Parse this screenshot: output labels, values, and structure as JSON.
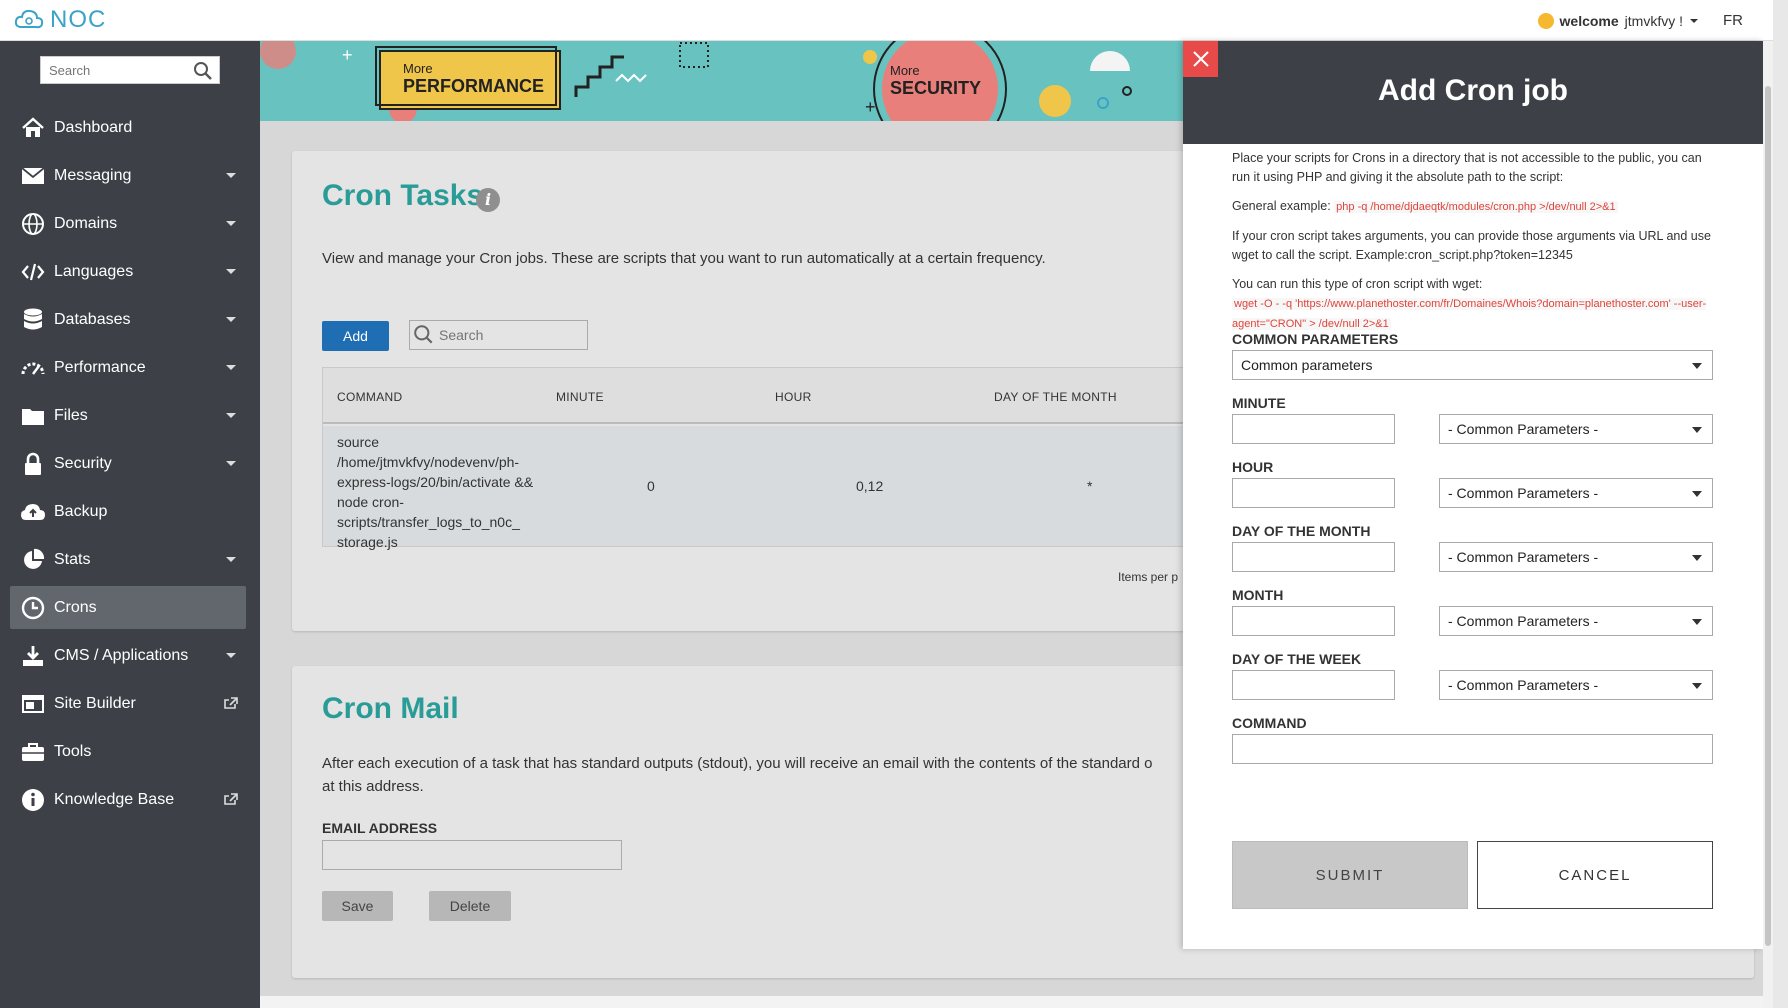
{
  "app": {
    "logo_text": "NOC"
  },
  "topbar": {
    "welcome_bold": "welcome",
    "username": "jtmvkfvy !",
    "language": "FR"
  },
  "sidebar": {
    "search_placeholder": "Search",
    "items": [
      {
        "label": "Dashboard",
        "icon": "home-icon",
        "caret": false,
        "external": false
      },
      {
        "label": "Messaging",
        "icon": "envelope-icon",
        "caret": true,
        "external": false
      },
      {
        "label": "Domains",
        "icon": "globe-icon",
        "caret": true,
        "external": false
      },
      {
        "label": "Languages",
        "icon": "code-icon",
        "caret": true,
        "external": false
      },
      {
        "label": "Databases",
        "icon": "database-icon",
        "caret": true,
        "external": false
      },
      {
        "label": "Performance",
        "icon": "gauge-icon",
        "caret": true,
        "external": false
      },
      {
        "label": "Files",
        "icon": "folder-icon",
        "caret": true,
        "external": false
      },
      {
        "label": "Security",
        "icon": "lock-icon",
        "caret": true,
        "external": false
      },
      {
        "label": "Backup",
        "icon": "cloud-upload-icon",
        "caret": false,
        "external": false
      },
      {
        "label": "Stats",
        "icon": "pie-chart-icon",
        "caret": true,
        "external": false
      },
      {
        "label": "Crons",
        "icon": "clock-icon",
        "caret": false,
        "external": false,
        "active": true
      },
      {
        "label": "CMS / Applications",
        "icon": "download-icon",
        "caret": true,
        "external": false
      },
      {
        "label": "Site Builder",
        "icon": "browser-icon",
        "caret": false,
        "external": true
      },
      {
        "label": "Tools",
        "icon": "toolbox-icon",
        "caret": false,
        "external": false
      },
      {
        "label": "Knowledge Base",
        "icon": "info-circle-icon",
        "caret": false,
        "external": true
      }
    ]
  },
  "banner": {
    "perf_small": "More",
    "perf_big": "PERFORMANCE",
    "sec_small": "More",
    "sec_big": "SECURITY"
  },
  "cron_tasks": {
    "title": "Cron Tasks",
    "description": "View and manage your Cron jobs. These are scripts that you want to run automatically at a certain frequency.",
    "add_label": "Add",
    "search_placeholder": "Search",
    "columns": [
      "COMMAND",
      "MINUTE",
      "HOUR",
      "DAY OF THE MONTH"
    ],
    "rows": [
      {
        "command": "source /home/jtmvkfvy/nodevenv/ph-express-logs/20/bin/activate && node cron-scripts/transfer_logs_to_n0c_ storage.js",
        "minute": "0",
        "hour": "0,12",
        "day": "*"
      }
    ],
    "items_per_page": "Items per p"
  },
  "cron_mail": {
    "title": "Cron Mail",
    "description_line1": "After each execution of a task that has standard outputs (stdout), you will receive an email with the contents of the standard o",
    "description_line2": "at this address.",
    "email_label": "EMAIL ADDRESS",
    "save_label": "Save",
    "delete_label": "Delete"
  },
  "panel": {
    "title": "Add Cron job",
    "intro": "Place your scripts for Crons in a directory that is not accessible to the public, you can run it using PHP and giving it the absolute path to the script:",
    "general_example_label": "General example:",
    "general_example_code": "php -q /home/djdaeqtk/modules/cron.php >/dev/null 2>&1",
    "args_text": "If your cron script takes arguments, you can provide those arguments via URL and use wget to call the script. Example:cron_script.php?token=12345",
    "wget_text": "You can run this type of cron script with wget:",
    "wget_code": "wget -O - -q 'https://www.planethoster.com/fr/Domaines/Whois?domain=planethoster.com' --user-agent=\"CRON\" > /dev/null 2>&1",
    "common_params_label": "COMMON PARAMETERS",
    "common_params_value": "Common parameters",
    "minute_label": "MINUTE",
    "hour_label": "HOUR",
    "day_month_label": "DAY OF THE MONTH",
    "month_label": "MONTH",
    "day_week_label": "DAY OF THE WEEK",
    "field_select_value": "- Common Parameters -",
    "command_label": "COMMAND",
    "submit_label": "SUBMIT",
    "cancel_label": "CANCEL"
  },
  "colors": {
    "accent": "#2a9c98",
    "sidebar": "#3d4147",
    "primary": "#1f6db3",
    "close": "#e84a4a",
    "code": "#e0443a"
  }
}
